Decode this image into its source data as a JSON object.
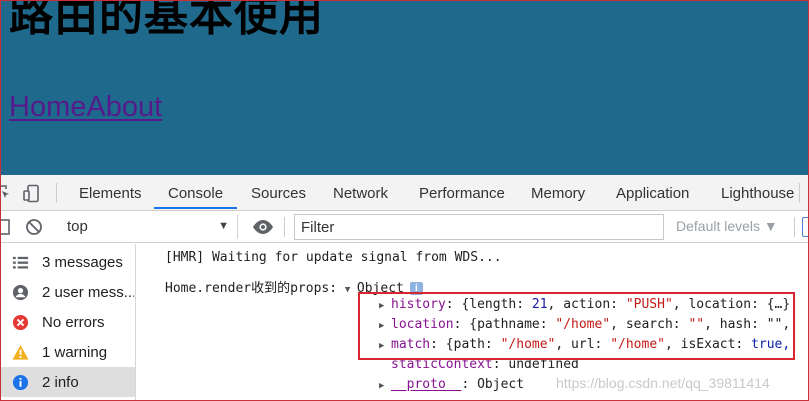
{
  "page": {
    "title": "路由的基本使用",
    "links": [
      "Home",
      "About"
    ]
  },
  "devtools": {
    "tabs": [
      "Elements",
      "Console",
      "Sources",
      "Network",
      "Performance",
      "Memory",
      "Application",
      "Lighthouse"
    ],
    "active_tab": "Console",
    "accent_color": "#1a73e8"
  },
  "toolbar": {
    "context": "top",
    "filter_placeholder": "Filter",
    "levels_label": "Default levels ▼"
  },
  "sidebar": {
    "items": [
      {
        "label": "3 messages",
        "icon": "list-icon"
      },
      {
        "label": "2 user mess...",
        "icon": "user-icon"
      },
      {
        "label": "No errors",
        "icon": "error-icon"
      },
      {
        "label": "1 warning",
        "icon": "warning-icon"
      },
      {
        "label": "2 info",
        "icon": "info-icon"
      }
    ],
    "selected_index": 4
  },
  "console": {
    "hmr": "[HMR] Waiting for update signal from WDS...",
    "log_prefix": "Home.render收到的props:",
    "object_label": "Object",
    "info_badge": "i",
    "history": {
      "key": "history",
      "open": ": {length: ",
      "length": "21",
      "sep1": ", action: ",
      "action": "\"PUSH\"",
      "sep2": ", location: {…}"
    },
    "location": {
      "key": "location",
      "open": ": {pathname: ",
      "pathname": "\"/home\"",
      "sep1": ", search: ",
      "search": "\"\"",
      "sep2": ", hash: \"\","
    },
    "match": {
      "key": "match",
      "open": ": {path: ",
      "path": "\"/home\"",
      "sep1": ", url: ",
      "url": "\"/home\"",
      "sep2": ", isExact: ",
      "isExact": "true,"
    },
    "static_context": {
      "key": "staticContext",
      "value": ": undefined"
    },
    "proto": {
      "key": "__proto__",
      "value": ": Object"
    },
    "highlight_color": "#d8262f"
  },
  "watermark": "https://blog.csdn.net/qq_39811414"
}
